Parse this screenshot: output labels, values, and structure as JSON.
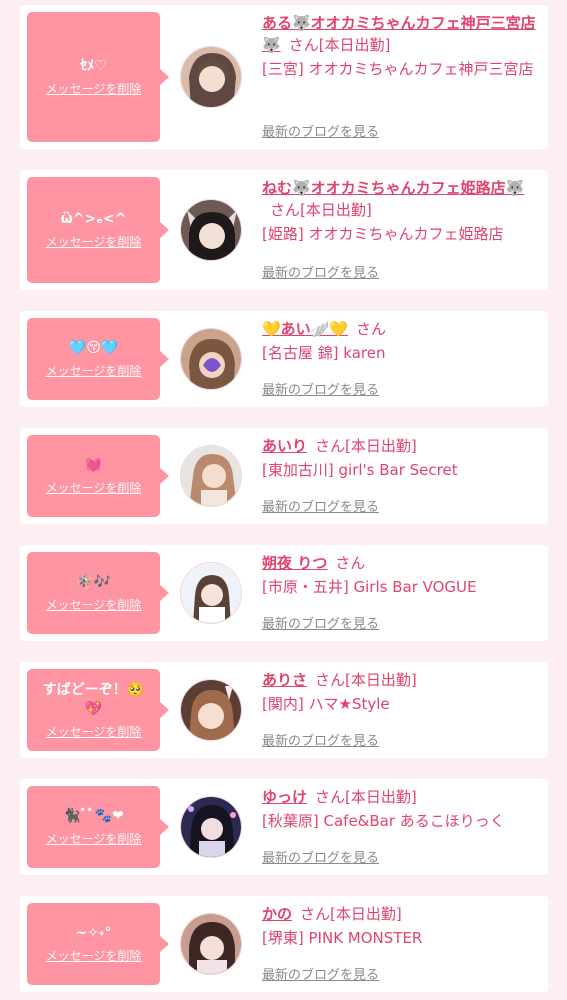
{
  "colors": {
    "page_background": "#fdeff1",
    "bubble": "#ff95a3",
    "accent_text": "#e2436c",
    "blog_link": "#8a8a8a"
  },
  "delete_label": "メッセージを削除",
  "san_label": "さん",
  "blog_label": "最新のブログを見る",
  "items": [
    {
      "message": "ｾﾒ♡",
      "name": "ある🐺オオカミちゃんカフェ神戸三宮店🐺",
      "status": "[本日出勤]",
      "area": "三宮",
      "shop": "オオカミちゃんカフェ神戸三宮店",
      "avatar_icon": "avatar-photo"
    },
    {
      "message": "ὣ^>ₑ<^",
      "name": "ねむ🐺オオカミちゃんカフェ姫路店🐺",
      "status": "[本日出勤]",
      "area": "姫路",
      "shop": "オオカミちゃんカフェ姫路店",
      "avatar_icon": "avatar-photo"
    },
    {
      "message": "🩵😚🩵",
      "name": "💛あい🪽💛",
      "status": "",
      "area": "名古屋 錦",
      "shop": "karen",
      "avatar_icon": "avatar-photo"
    },
    {
      "message": "💓",
      "name": "あいり",
      "status": "[本日出勤]",
      "area": "東加古川",
      "shop": "girl's Bar Secret",
      "avatar_icon": "avatar-photo"
    },
    {
      "message": "🪅🎶",
      "name": "朔夜 りつ",
      "status": "",
      "area": "市原・五井",
      "shop": "Girls Bar VOGUE",
      "avatar_icon": "avatar-photo"
    },
    {
      "message": "すばどーぞ！🥺\n💖",
      "name": "ありさ",
      "status": "[本日出勤]",
      "area": "関内",
      "shop": "ハマ★Style",
      "avatar_icon": "avatar-photo"
    },
    {
      "message": "🐈‍⬛ﾞﾞ🐾❤",
      "name": "ゆっけ",
      "status": "[本日出勤]",
      "area": "秋葉原",
      "shop": "Cafe&Bar あるこほりっく",
      "avatar_icon": "avatar-photo"
    },
    {
      "message": "~✧˖°",
      "name": "かの",
      "status": "[本日出勤]",
      "area": "堺東",
      "shop": "PINK MONSTER",
      "avatar_icon": "avatar-photo"
    }
  ]
}
